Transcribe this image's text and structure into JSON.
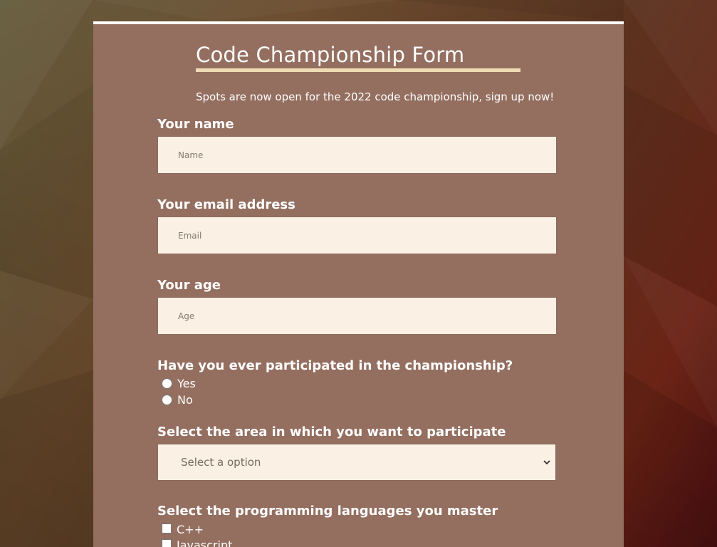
{
  "form": {
    "title": "Code Championship Form",
    "subtitle": "Spots are now open for the 2022 code championship, sign up now!",
    "name": {
      "label": "Your name",
      "placeholder": "Name"
    },
    "email": {
      "label": "Your email address",
      "placeholder": "Email"
    },
    "age": {
      "label": "Your age",
      "placeholder": "Age"
    },
    "participated": {
      "label": "Have you ever participated in the championship?",
      "options": [
        "Yes",
        "No"
      ]
    },
    "area": {
      "label": "Select the area in which you want to participate",
      "selected": "Select a option"
    },
    "languages": {
      "label": "Select the programming languages you master",
      "options": [
        "C++",
        "Javascript"
      ]
    }
  },
  "colors": {
    "card": "#946f60",
    "input_bg": "#faf0e4",
    "underline": "#f0dcb4",
    "text": "#ffffff"
  },
  "icons": {
    "select_chevron": "chevron-down-icon"
  }
}
